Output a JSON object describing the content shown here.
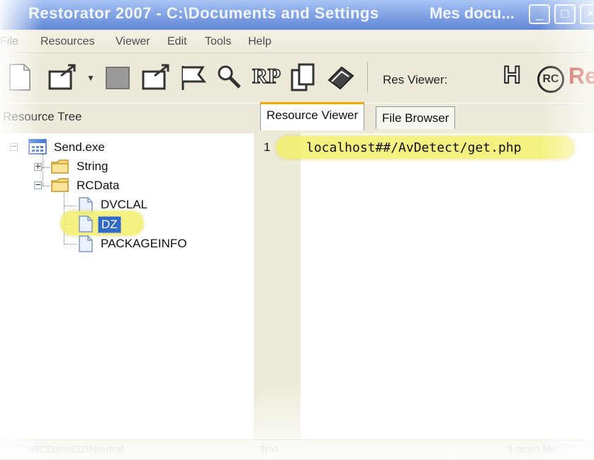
{
  "window": {
    "title": "Restorator 2007 - C:\\Documents and Settings",
    "title_right": "Mes docu..."
  },
  "menu": [
    "File",
    "Resources",
    "Viewer",
    "Edit",
    "Tools",
    "Help"
  ],
  "toolbar": {
    "res_viewer_label": "Res Viewer:",
    "rp_label": "RP",
    "h_label": "H",
    "rc_label": "RC",
    "re_label": "Re"
  },
  "tree_pane": {
    "header": "Resource Tree",
    "root": "Send.exe",
    "string": "String",
    "rcdata": "RCData",
    "items": [
      "DVCLAL",
      "DZ",
      "PACKAGEINFO"
    ],
    "selected": "DZ"
  },
  "tabs": {
    "resource_viewer": "Resource Viewer",
    "file_browser": "File Browser",
    "active": "Resource Viewer"
  },
  "editor": {
    "line_number": "1",
    "code": "localhost##/AvDetect/get.php"
  },
  "statusbar": {
    "left": "\\RCData\\DZ\\Neutral",
    "middle": "Text",
    "right": "1 open file"
  },
  "colors": {
    "title_bar": "#2a62d2",
    "chrome": "#ece9d8",
    "highlight": "#f3ef6a",
    "active_tab_accent": "#f6a400",
    "selection": "#316ac5"
  }
}
